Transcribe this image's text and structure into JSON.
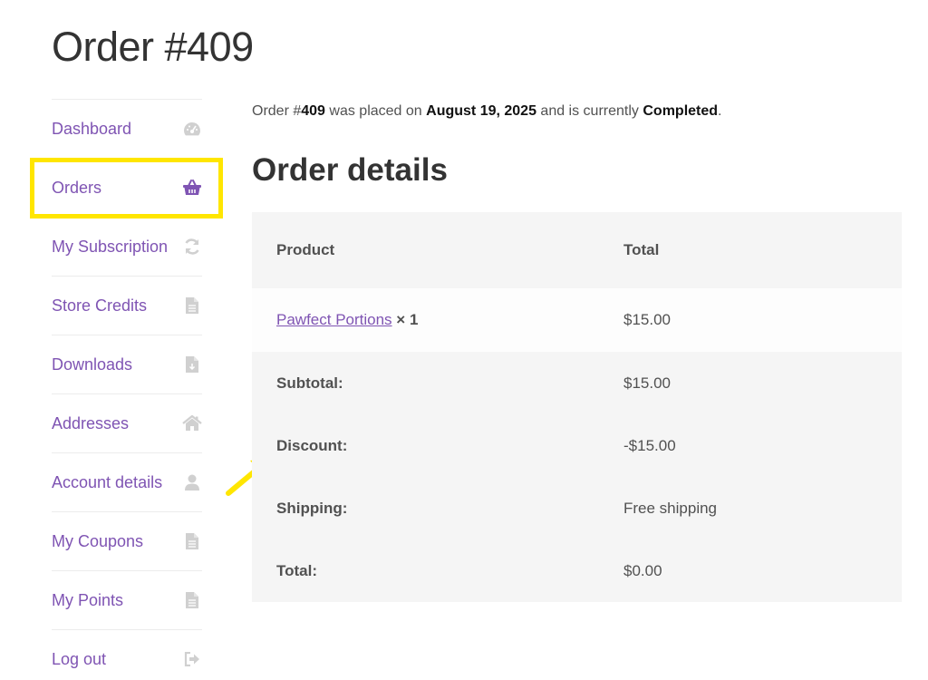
{
  "page": {
    "title": "Order #409"
  },
  "nav": {
    "items": [
      {
        "label": "Dashboard",
        "icon": "dashboard-icon"
      },
      {
        "label": "Orders",
        "icon": "basket-icon",
        "active": true
      },
      {
        "label": "My Subscription",
        "icon": "refresh-icon"
      },
      {
        "label": "Store Credits",
        "icon": "document-icon"
      },
      {
        "label": "Downloads",
        "icon": "file-download-icon"
      },
      {
        "label": "Addresses",
        "icon": "home-icon"
      },
      {
        "label": "Account details",
        "icon": "user-icon"
      },
      {
        "label": "My Coupons",
        "icon": "document-icon"
      },
      {
        "label": "My Points",
        "icon": "document-icon"
      },
      {
        "label": "Log out",
        "icon": "logout-icon"
      }
    ]
  },
  "notice": {
    "prefix": "Order #",
    "order_number": "409",
    "placed_text": " was placed on ",
    "date": "August 19, 2025",
    "status_text": " and is currently ",
    "status": "Completed",
    "suffix": "."
  },
  "order_details": {
    "title": "Order details",
    "headers": {
      "product": "Product",
      "total": "Total"
    },
    "items": [
      {
        "name": "Pawfect Portions",
        "qty": "× 1",
        "total": "$15.00"
      }
    ],
    "totals": [
      {
        "label": "Subtotal:",
        "value": "$15.00"
      },
      {
        "label": "Discount:",
        "value": "-$15.00"
      },
      {
        "label": "Shipping:",
        "value": "Free shipping"
      },
      {
        "label": "Total:",
        "value": "$0.00"
      }
    ]
  },
  "colors": {
    "accent": "#7f54b3",
    "highlight": "#ffe600",
    "table_bg": "#f5f5f5",
    "icon_gray": "#d0d0d0"
  }
}
